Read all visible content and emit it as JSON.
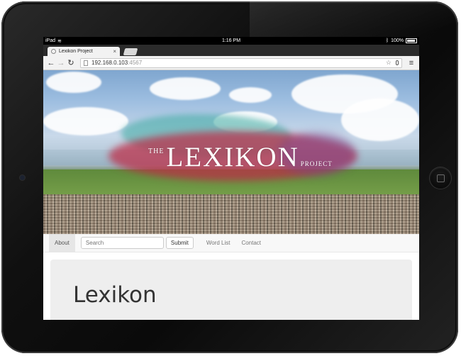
{
  "device": {
    "status_bar": {
      "carrier": "iPad",
      "time": "1:16 PM",
      "battery": "100%"
    }
  },
  "browser": {
    "tab": {
      "title": "Lexikon Project",
      "close": "×"
    },
    "url": {
      "host": "192.168.0.103",
      "port": ":4567"
    },
    "icons": {
      "back": "back-arrow-icon",
      "forward": "forward-arrow-icon",
      "reload": "reload-icon",
      "bookmark": "star-icon",
      "voice": "microphone-icon",
      "menu": "hamburger-menu-icon"
    }
  },
  "page": {
    "logo": {
      "the": "THE",
      "main": "LEXIKON",
      "project": "PROJECT"
    },
    "navbar": {
      "about": "About",
      "search_placeholder": "Search",
      "submit": "Submit",
      "word_list": "Word List",
      "contact": "Contact"
    },
    "jumbotron": {
      "heading": "Lexikon"
    }
  }
}
